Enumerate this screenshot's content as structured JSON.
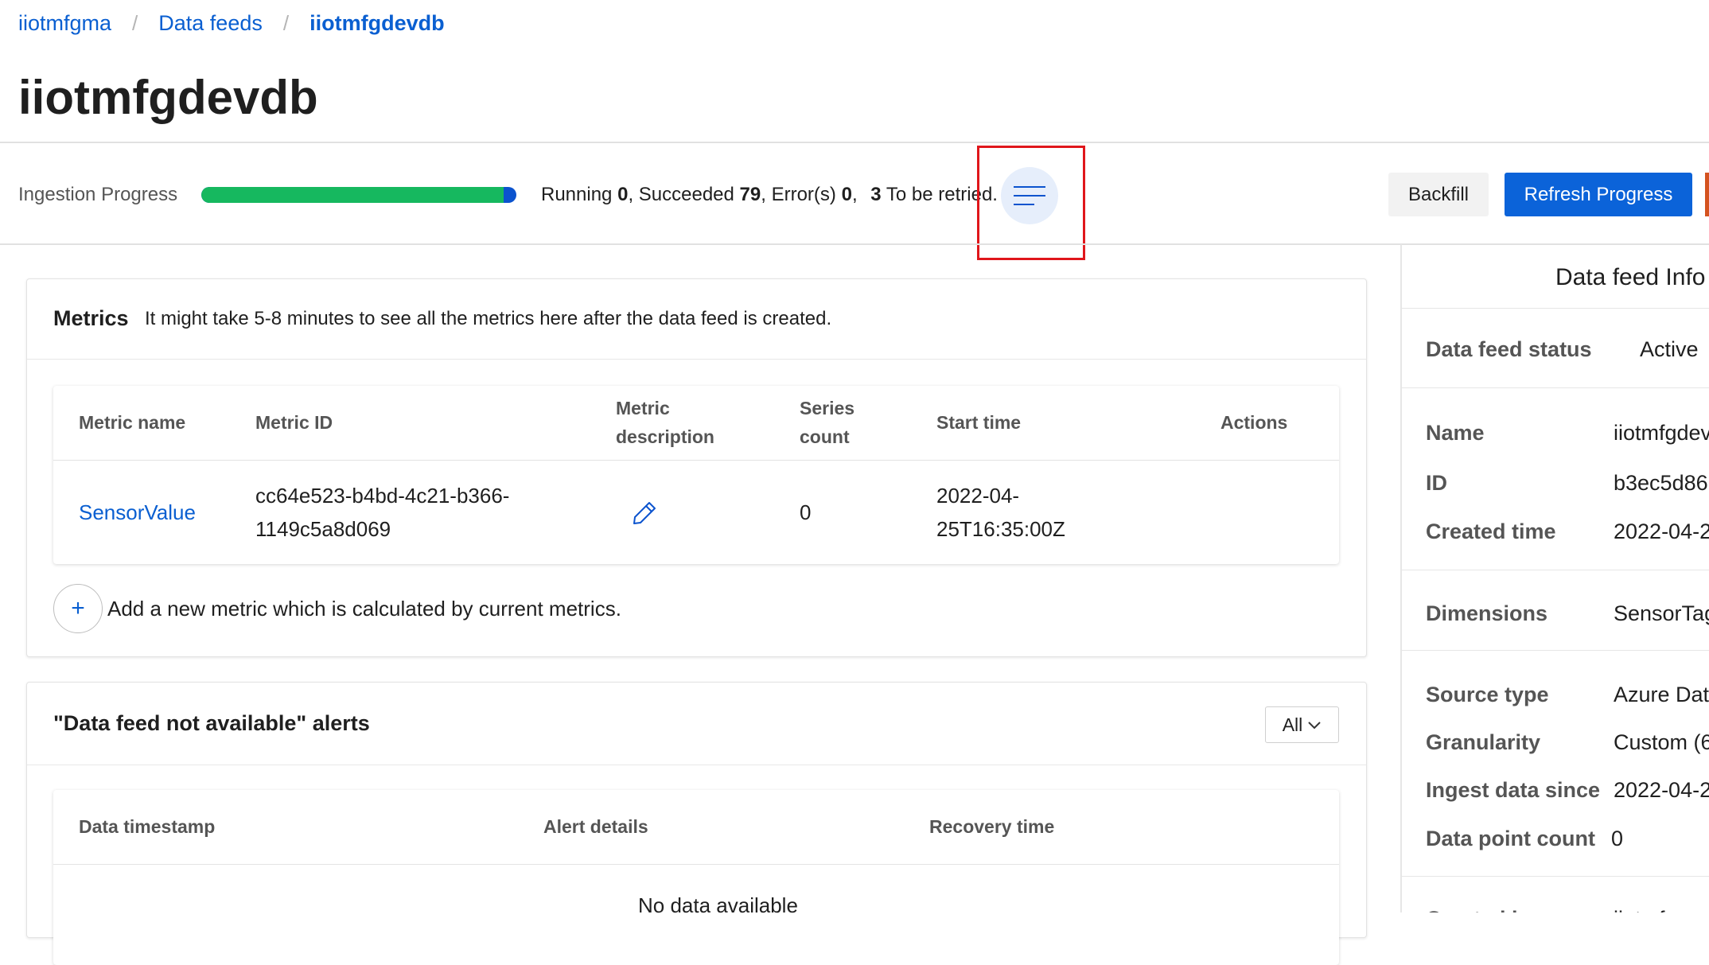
{
  "breadcrumb": {
    "items": [
      "iiotmfgma",
      "Data feeds",
      "iiotmfgdevdb"
    ],
    "separator": "/"
  },
  "page": {
    "title": "iiotmfgdevdb"
  },
  "ingestion": {
    "label": "Ingestion Progress",
    "progress_fraction": 0.96,
    "running_label": "Running",
    "running": "0",
    "succeeded_label": "Succeeded",
    "succeeded": "79",
    "errors_label": "Error(s)",
    "errors": "0",
    "retry": "3",
    "retry_label": "To be retried.",
    "list_icon": "list-icon"
  },
  "toolbar": {
    "backfill_label": "Backfill",
    "refresh_label": "Refresh Progress"
  },
  "metrics": {
    "title": "Metrics",
    "hint": "It might take 5-8 minutes to see all the metrics here after the data feed is created.",
    "columns": {
      "name": "Metric name",
      "id": "Metric ID",
      "description_1": "Metric",
      "description_2": "description",
      "series_1": "Series",
      "series_2": "count",
      "start_time": "Start time",
      "actions": "Actions"
    },
    "rows": [
      {
        "name": "SensorValue",
        "id_line1": "cc64e523-b4bd-4c21-b366-",
        "id_line2": "1149c5a8d069",
        "description_icon": "pencil-icon",
        "series_count": "0",
        "start_line1": "2022-04-",
        "start_line2": "25T16:35:00Z"
      }
    ],
    "add_symbol": "+",
    "add_label": "Add a new metric which is calculated by current metrics."
  },
  "alerts": {
    "title": "\"Data feed not available\" alerts",
    "filter_value": "All",
    "columns": {
      "timestamp": "Data timestamp",
      "details": "Alert details",
      "recovery": "Recovery time"
    },
    "empty_text": "No data available"
  },
  "info": {
    "title": "Data feed Info",
    "status_label": "Data feed status",
    "status_value": "Active",
    "name_label": "Name",
    "name_value": "iiotmfgdev",
    "id_label": "ID",
    "id_value": "b3ec5d86",
    "created_label": "Created time",
    "created_value": "2022-04-2",
    "dimensions_label": "Dimensions",
    "dimensions_value": "SensorTag",
    "source_label": "Source type",
    "source_value": "Azure Dat",
    "granularity_label": "Granularity",
    "granularity_value": "Custom (6",
    "ingest_label": "Ingest data since",
    "ingest_value": "2022-04-2",
    "points_label": "Data point count",
    "points_value": "0",
    "creator_label": "Created by",
    "creator_value": "iiotmfg"
  },
  "colors": {
    "link": "#0a5fd1",
    "primary_button": "#0b63d9",
    "progress_success": "#16b85f",
    "progress_remaining": "#0b53ce",
    "highlight_box": "#e0161b"
  }
}
